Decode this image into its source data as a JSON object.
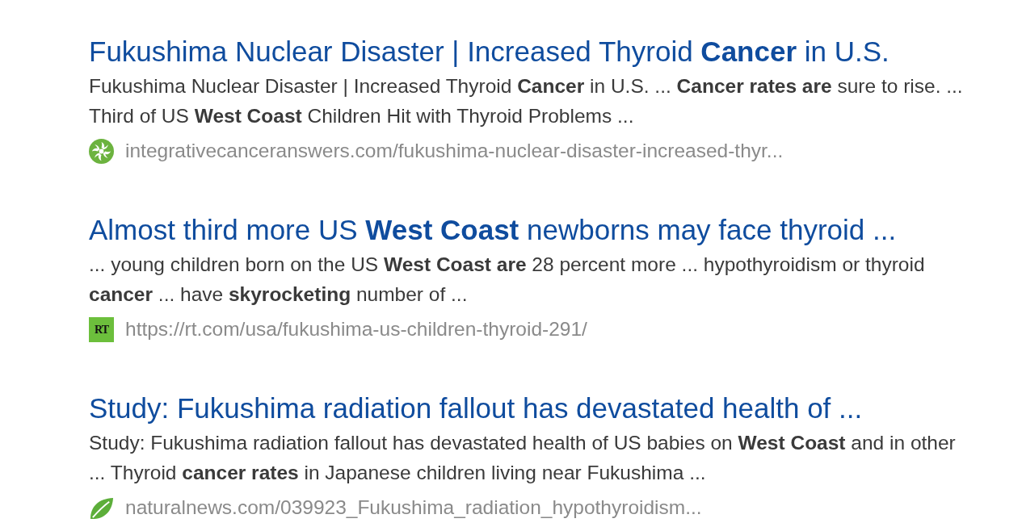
{
  "results": [
    {
      "title": "Fukushima Nuclear Disaster | Increased Thyroid **Cancer** in U.S.",
      "snippet": "Fukushima Nuclear Disaster | Increased Thyroid **Cancer** in U.S. ... **Cancer rates are** sure to rise. ... Third of US **West Coast** Children Hit with Thyroid Problems ...",
      "url": "integrativecanceranswers.com/fukushima-nuclear-disaster-increased-thyr...",
      "favicon": {
        "kind": "swirl"
      }
    },
    {
      "title": "Almost third more US **West Coast** newborns may face thyroid ...",
      "snippet": "... young children born on the US **West Coast are** 28 percent more ... hypothyroidism or thyroid **cancer** ... have **skyrocketing** number of ...",
      "url": "https://rt.com/usa/fukushima-us-children-thyroid-291/",
      "favicon": {
        "kind": "letters",
        "text": "RT"
      }
    },
    {
      "title": "Study: Fukushima radiation fallout has devastated health of ...",
      "snippet": "Study: Fukushima radiation fallout has devastated health of US babies on **West Coast** and in other ... Thyroid **cancer rates** in Japanese children living near Fukushima ...",
      "url": "naturalnews.com/039923_Fukushima_radiation_hypothyroidism...",
      "favicon": {
        "kind": "leaf"
      }
    }
  ]
}
